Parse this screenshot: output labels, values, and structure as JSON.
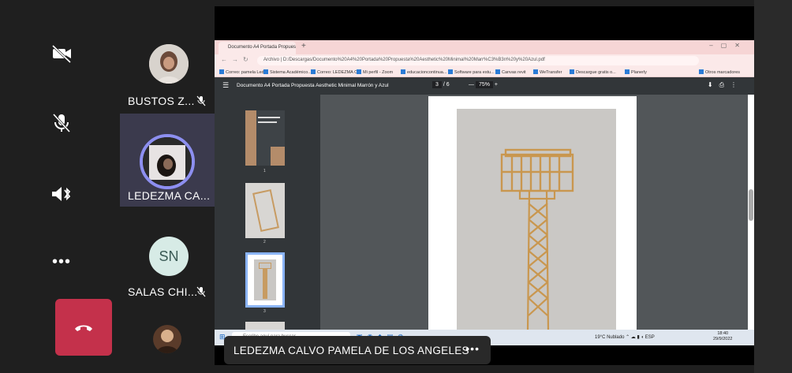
{
  "controls": {
    "camera_icon": "camera-off-icon",
    "mic_icon": "mic-off-icon",
    "speaker_icon": "speaker-bluetooth-icon",
    "more_label": "•••",
    "leave_icon": "hang-up-icon"
  },
  "participants": [
    {
      "name": "BUSTOS Z...",
      "muted": true
    },
    {
      "name": "LEDEZMA CA...",
      "muted": false,
      "active": true
    },
    {
      "name": "SALAS CHI...",
      "initials": "SN",
      "muted": true
    },
    {
      "name": ""
    }
  ],
  "browser": {
    "tab_title": "Documento A4 Portada Propuest",
    "address": "Archivo | D:/Descargas/Documento%20A4%20Portada%20Propuesta%20Aesthetic%20Minimal%20Marr%C3%B3n%20y%20Azul.pdf",
    "bookmarks": [
      "Correo: pamela Led...",
      "Sistema Académico...",
      "Correo: LEDEZMA C...",
      "Mi perfil - Zoom",
      "educacioncontinua...",
      "Software para estu...",
      "Canvas revit",
      "WeTransfer",
      "Descargue gratis o...",
      "Planerly",
      "Otros marcadores"
    ]
  },
  "pdf": {
    "title": "Documento A4 Portada Propuesta Aesthetic Minimal Marrón y Azul",
    "page_current": "3",
    "page_total": "/ 6",
    "zoom": "75%",
    "thumbnails": [
      "1",
      "2",
      "3"
    ]
  },
  "taskbar": {
    "search_placeholder": "Escribe aquí para buscar",
    "weather": "19°C Nublado",
    "lang": "ESP",
    "time": "18:40",
    "date": "29/9/2022"
  },
  "presenter": {
    "name": "LEDEZMA CALVO PAMELA DE LOS ANGELES",
    "more": "•••"
  },
  "colors": {
    "leave": "#c4314b",
    "active_tile": "#3b3a4d",
    "pdf_toolbar": "#323639"
  }
}
